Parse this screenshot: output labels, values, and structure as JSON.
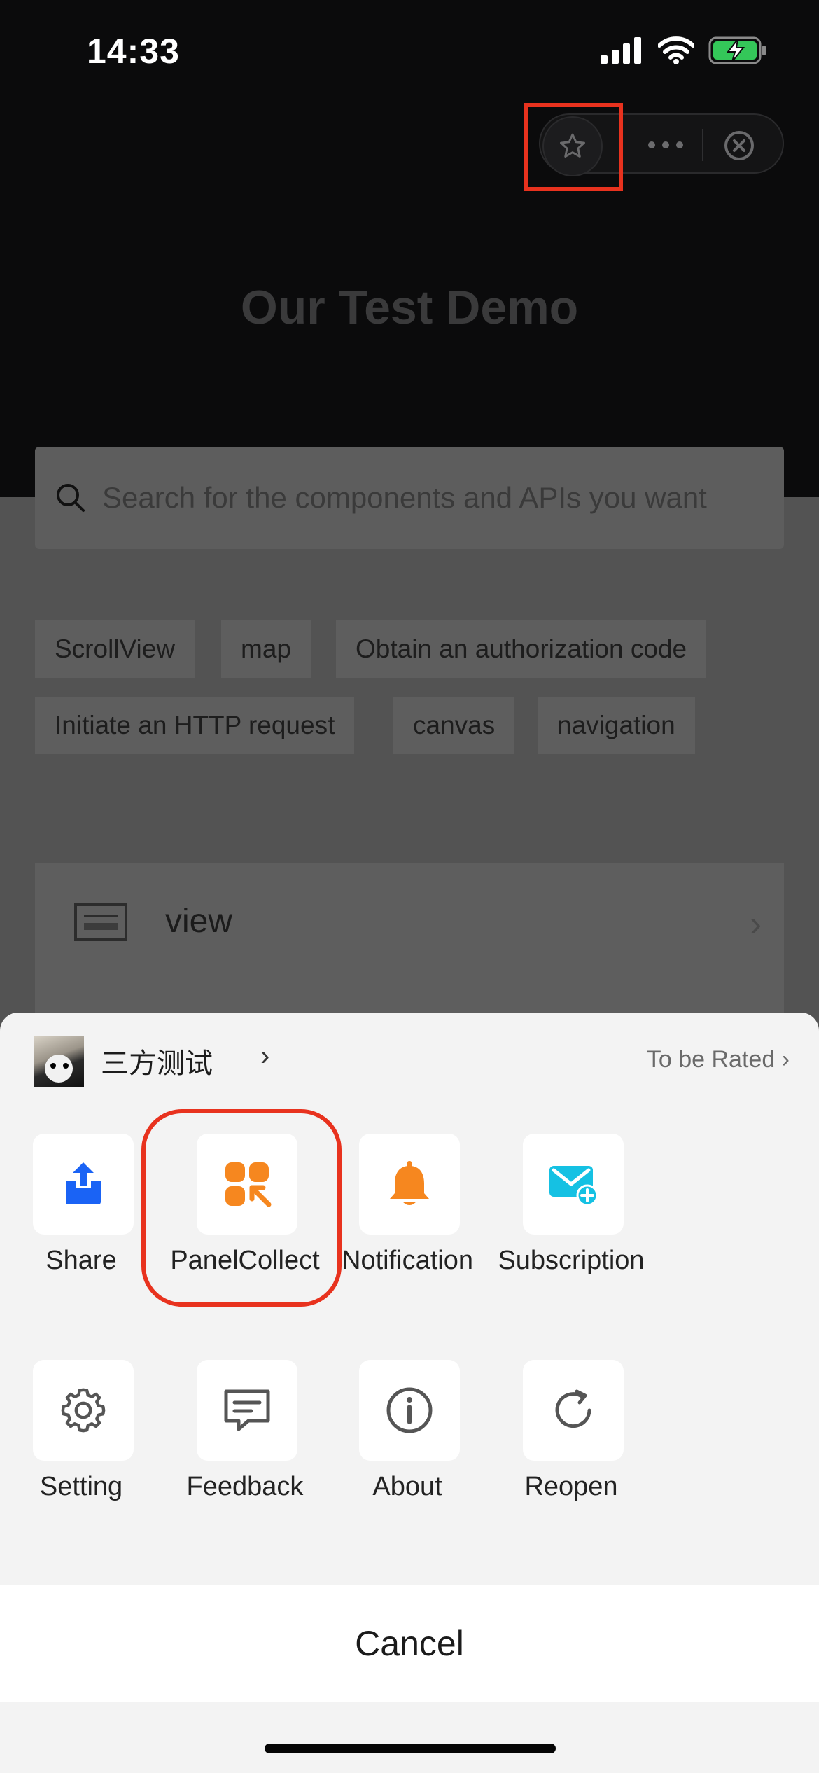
{
  "status_bar": {
    "time": "14:33"
  },
  "page": {
    "title": "Our Test Demo",
    "search_placeholder": "Search for the components and APIs you want",
    "tags": [
      "ScrollView",
      "map",
      "Obtain an authorization code",
      "Initiate an HTTP request",
      "canvas",
      "navigation"
    ],
    "list_item": {
      "label": "view"
    }
  },
  "sheet": {
    "app_name": "三方测试",
    "app_chevron": "›",
    "rated": "To be Rated ›",
    "row1": [
      {
        "label": "Share",
        "icon": "share-icon"
      },
      {
        "label": "PanelCollect",
        "icon": "panel-collect-icon"
      },
      {
        "label": "Notification",
        "icon": "bell-icon"
      },
      {
        "label": "Subscription",
        "icon": "subscription-mail-icon"
      }
    ],
    "row2": [
      {
        "label": "Setting",
        "icon": "gear-icon"
      },
      {
        "label": "Feedback",
        "icon": "feedback-chat-icon"
      },
      {
        "label": "About",
        "icon": "info-icon"
      },
      {
        "label": "Reopen",
        "icon": "reload-icon"
      }
    ],
    "cancel": "Cancel"
  },
  "colors": {
    "accent_blue": "#1a63f5",
    "accent_orange": "#f6871f",
    "accent_cyan": "#15c1e3",
    "highlight_red": "#e8321e"
  }
}
